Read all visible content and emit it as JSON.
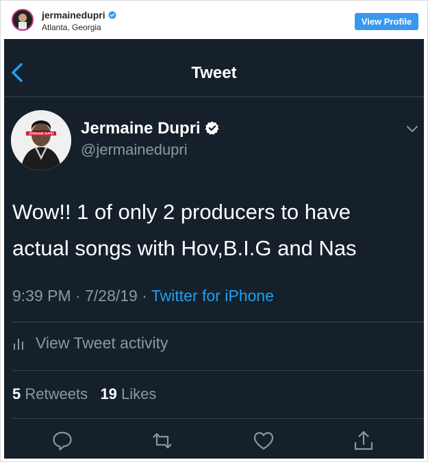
{
  "instagram": {
    "username": "jermainedupri",
    "location": "Atlanta, Georgia",
    "view_profile_label": "View Profile"
  },
  "tweet": {
    "nav_title": "Tweet",
    "author_name": "Jermaine Dupri",
    "author_handle": "@jermainedupri",
    "avatar_banner_text": "JERMAINE DUPRI",
    "text_line1": "Wow!! 1 of only 2 producers to have",
    "text_line2": "actual songs with Hov,B.I.G and Nas",
    "time": "9:39 PM",
    "date": "7/28/19",
    "source": "Twitter for iPhone",
    "activity_label": "View Tweet activity",
    "retweets_count": "5",
    "retweets_label": "Retweets",
    "likes_count": "19",
    "likes_label": "Likes"
  },
  "icons": [
    "back-chevron-icon",
    "verified-icon",
    "chevron-down-icon",
    "bar-chart-icon",
    "reply-icon",
    "retweet-icon",
    "like-icon",
    "share-icon"
  ],
  "colors": {
    "background": "#15202b",
    "secondary_text": "#8899a6",
    "accent": "#1da1f2",
    "divider": "#38444d",
    "ig_button": "#3897f0"
  }
}
